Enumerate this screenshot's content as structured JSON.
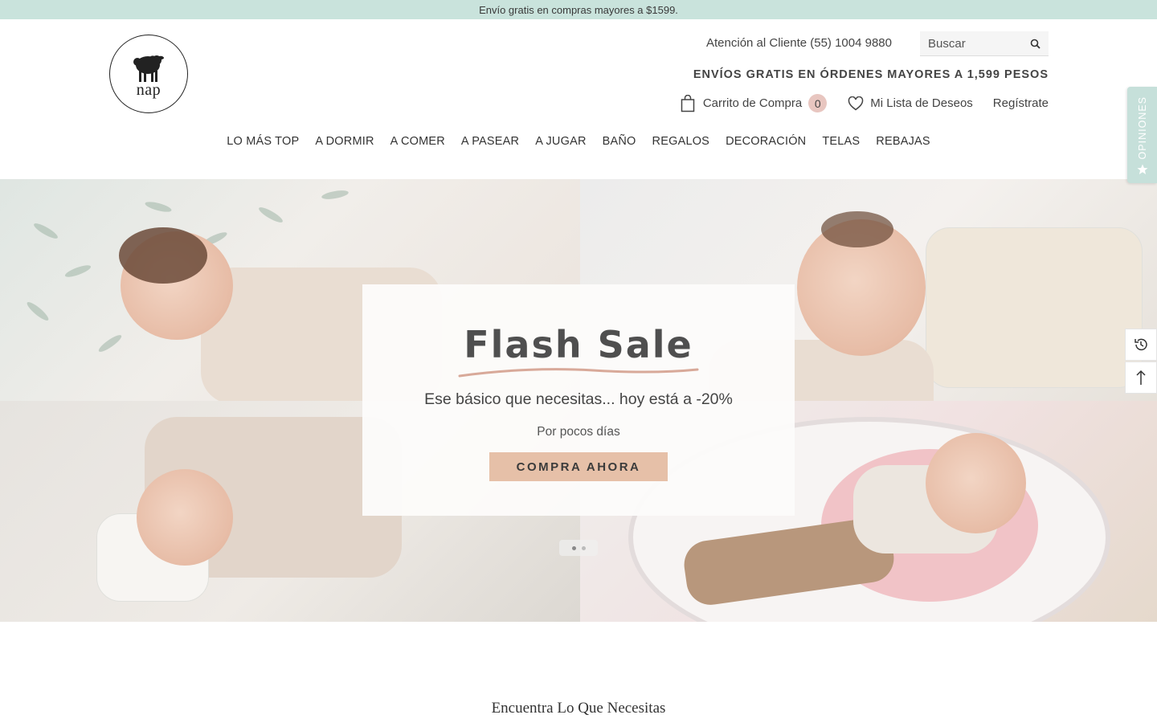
{
  "announcement": "Envío gratis en compras mayores a $1599.",
  "header": {
    "logo_text": "nap",
    "customer_service": "Atención al Cliente (55) 1004 9880",
    "search_placeholder": "Buscar",
    "shipping_note": "ENVÍOS GRATIS EN ÓRDENES MAYORES A 1,599 PESOS",
    "cart_label": "Carrito de Compra",
    "cart_count": "0",
    "wishlist_label": "Mi Lista de Deseos",
    "register_label": "Regístrate"
  },
  "nav": {
    "items": [
      "LO MÁS TOP",
      "A DORMIR",
      "A COMER",
      "A PASEAR",
      "A JUGAR",
      "BAÑO",
      "REGALOS",
      "DECORACIÓN",
      "TELAS",
      "REBAJAS"
    ]
  },
  "hero": {
    "title": "Flash Sale",
    "subtitle": "Ese básico que necesitas... hoy está a -20%",
    "small_text": "Por pocos días",
    "cta": "COMPRA AHORA"
  },
  "reviews_tab": "OPINIONES",
  "section_title": "Encuentra Lo Que Necesitas",
  "icons": {
    "search": "search-icon",
    "cart": "shopping-bag-icon",
    "wishlist": "heart-icon",
    "recent": "history-icon",
    "top": "arrow-up-icon",
    "star": "star-icon"
  },
  "colors": {
    "announcement_bg": "#c9e3dc",
    "cart_badge": "#e8c6c0",
    "cta_bg": "#e6c0a8",
    "reviews_tab_bg": "#c6e0da",
    "underline_accent": "#d8a999"
  }
}
